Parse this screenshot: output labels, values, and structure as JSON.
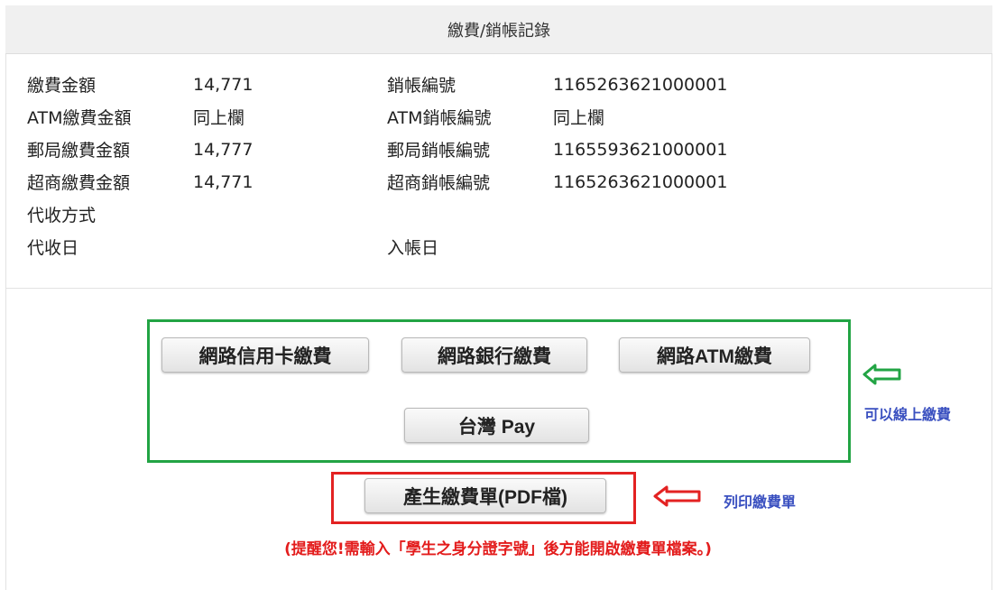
{
  "header": {
    "title": "繳費/銷帳記錄"
  },
  "details_left": [
    {
      "label": "繳費金額",
      "value": "14,771"
    },
    {
      "label": "ATM繳費金額",
      "value": "同上欄"
    },
    {
      "label": "郵局繳費金額",
      "value": "14,777"
    },
    {
      "label": "超商繳費金額",
      "value": "14,771"
    },
    {
      "label": "代收方式",
      "value": ""
    },
    {
      "label": "代收日",
      "value": ""
    }
  ],
  "details_right": [
    {
      "label": "銷帳編號",
      "value": "1165263621000001"
    },
    {
      "label": "ATM銷帳編號",
      "value": "同上欄"
    },
    {
      "label": "郵局銷帳編號",
      "value": "1165593621000001"
    },
    {
      "label": "超商銷帳編號",
      "value": "1165263621000001"
    },
    {
      "label": "入帳日",
      "value": ""
    }
  ],
  "payment_buttons": {
    "credit_card": "網路信用卡繳費",
    "bank": "網路銀行繳費",
    "atm": "網路ATM繳費",
    "taiwan_pay": "台灣 Pay"
  },
  "pdf_button": "產生繳費單(PDF檔)",
  "annotations": {
    "online_pay_note": "可以線上繳費",
    "print_note": "列印繳費單",
    "green_color": "#22a444",
    "red_color": "#e32222"
  },
  "warning": "(提醒您!需輸入「學生之身分證字號」後方能開啟繳費單檔案。)"
}
